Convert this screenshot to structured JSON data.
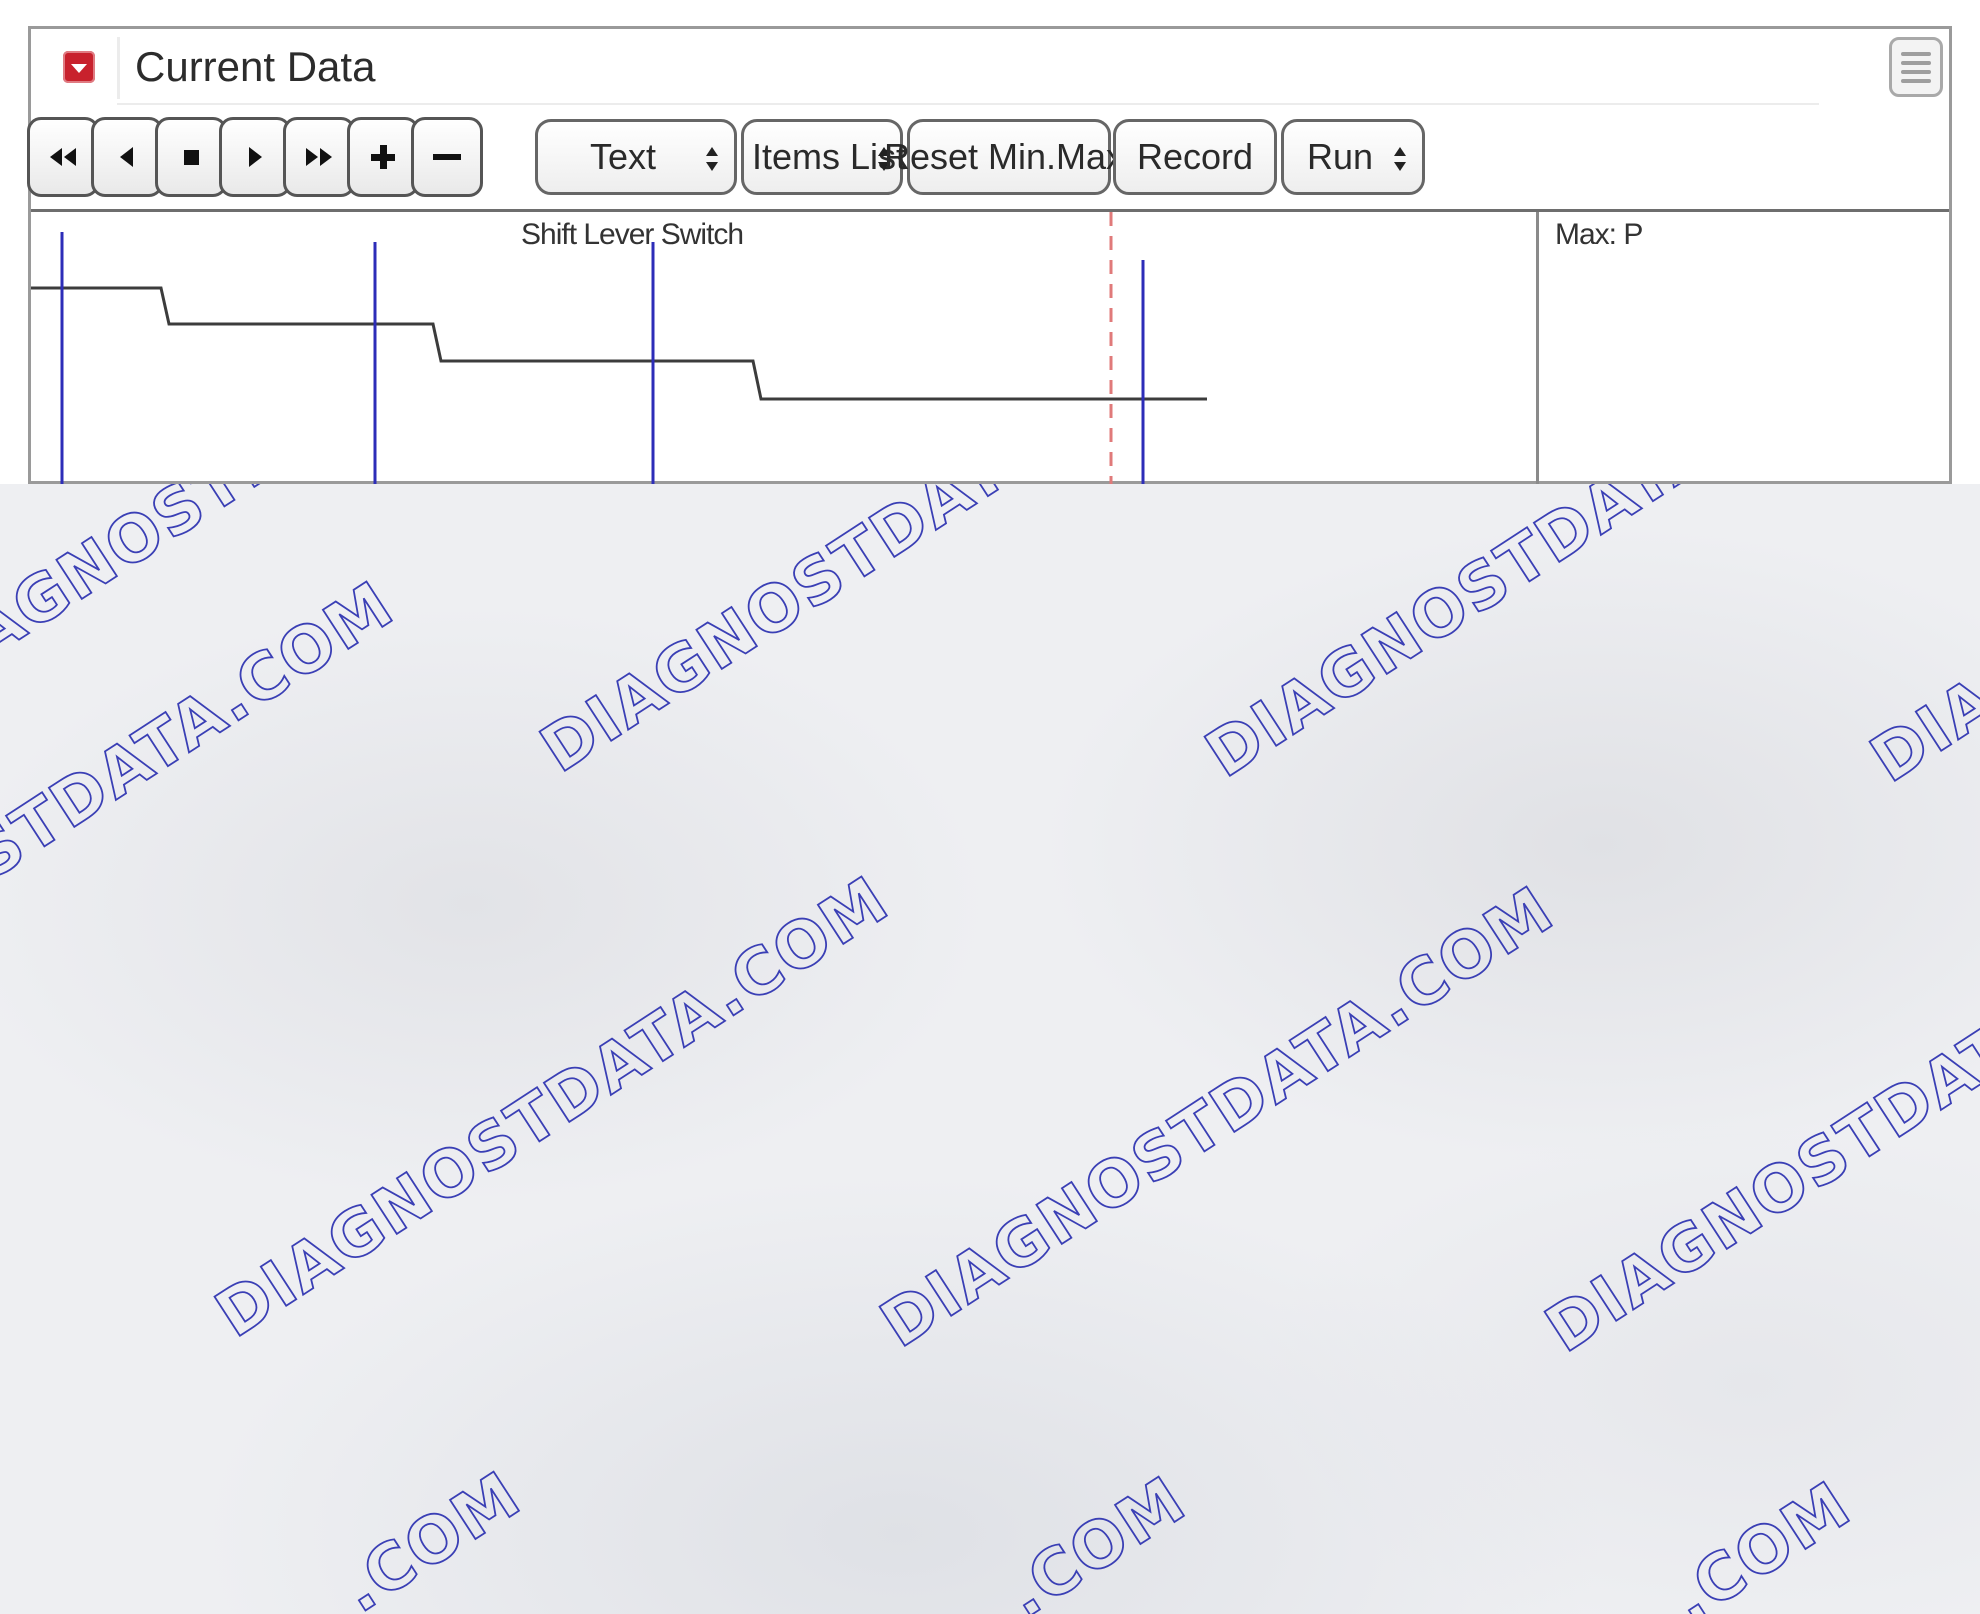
{
  "window": {
    "title": "Current Data"
  },
  "toolbar": {
    "playback_buttons": [
      {
        "name": "fast-rewind-button",
        "icon": "fast-rewind-icon"
      },
      {
        "name": "step-back-button",
        "icon": "step-back-icon"
      },
      {
        "name": "stop-button",
        "icon": "stop-icon"
      },
      {
        "name": "play-button",
        "icon": "play-icon"
      },
      {
        "name": "fast-forward-button",
        "icon": "fast-forward-icon"
      },
      {
        "name": "zoom-in-button",
        "icon": "plus-icon"
      },
      {
        "name": "zoom-out-button",
        "icon": "minus-icon"
      }
    ],
    "display_mode": "Text",
    "items_list": "Items List",
    "reset_min_max": "Reset Min.Max.",
    "record": "Record",
    "run_mode": "Run"
  },
  "graph": {
    "title": "Shift Lever Switch",
    "side_label": "Max: P",
    "colors": {
      "signal": "#3c3c3c",
      "marker": "#2d2db8",
      "cursor": "#e07a7a"
    }
  },
  "watermark": {
    "text_domain": "DIAGNOSTDATA",
    "text_suffix": "DIAGNOSTDATA.COM",
    "text_fragment_com": ".COM",
    "color": "#3a3fb5"
  }
}
